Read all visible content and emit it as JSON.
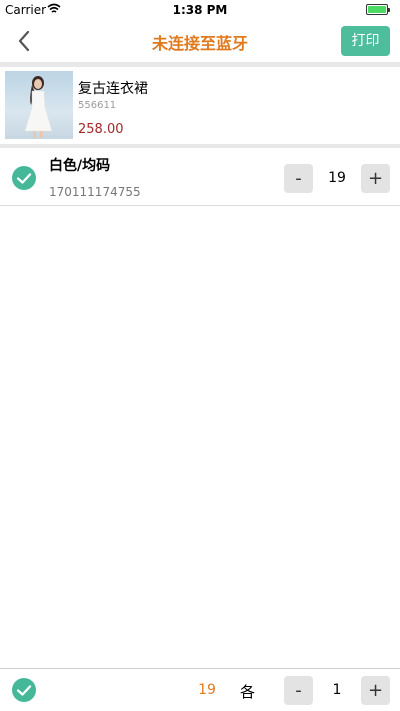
{
  "status_bar": {
    "carrier": "Carrier",
    "time": "1:38 PM"
  },
  "nav": {
    "title": "未连接至蓝牙",
    "print_label": "打印"
  },
  "product": {
    "name": "复古连衣裙",
    "code": "556611",
    "price": "258.00"
  },
  "sku": {
    "name": "白色/均码",
    "code": "170111174755",
    "quantity": "19",
    "minus": "-",
    "plus": "+"
  },
  "footer": {
    "total_quantity": "19",
    "unit_label": "各",
    "quantity": "1",
    "minus": "-",
    "plus": "+"
  },
  "colors": {
    "accent": "#e07a1f",
    "primary_button": "#4dbd9b",
    "check": "#45b89a",
    "price": "#a2282a"
  }
}
